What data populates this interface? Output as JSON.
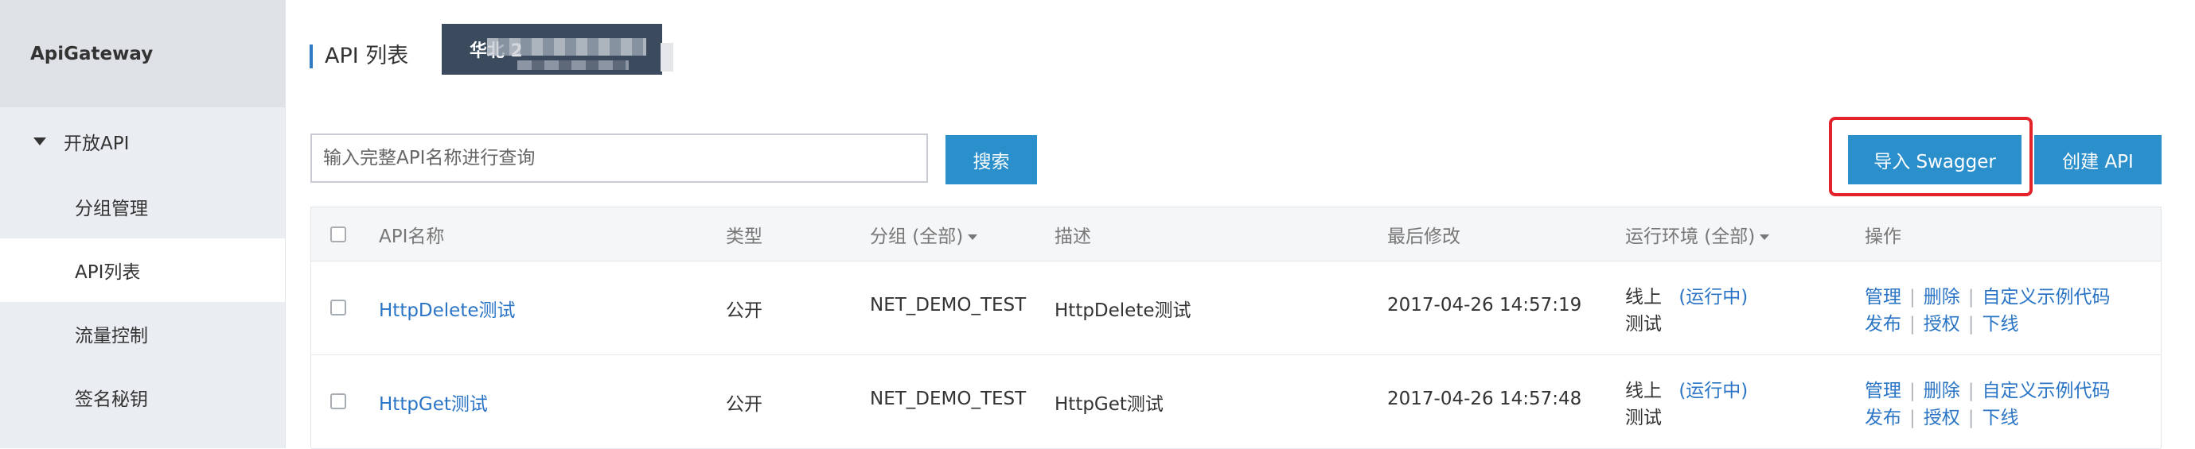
{
  "sidebar": {
    "title": "ApiGateway",
    "group_label": "开放API",
    "items": [
      {
        "label": "分组管理",
        "active": false
      },
      {
        "label": "API列表",
        "active": true
      },
      {
        "label": "流量控制",
        "active": false
      },
      {
        "label": "签名秘钥",
        "active": false
      }
    ]
  },
  "header": {
    "page_title": "API 列表",
    "region_label": "华北 2"
  },
  "search": {
    "placeholder": "输入完整API名称进行查询",
    "value": "",
    "button_label": "搜索"
  },
  "actions": {
    "import_label": "导入 Swagger",
    "create_label": "创建 API"
  },
  "table": {
    "headers": {
      "name": "API名称",
      "type": "类型",
      "group": "分组 (全部)",
      "desc": "描述",
      "modified": "最后修改",
      "env": "运行环境 (全部)",
      "ops": "操作"
    },
    "rows": [
      {
        "name": "HttpDelete测试",
        "type": "公开",
        "group": "NET_DEMO_TEST",
        "desc": "HttpDelete测试",
        "modified": "2017-04-26 14:57:19",
        "env_line1": "线上",
        "env_status": "(运行中)",
        "env_line2": "测试",
        "op_manage": "管理",
        "op_delete": "删除",
        "op_custom_code": "自定义示例代码",
        "op_publish": "发布",
        "op_authorize": "授权",
        "op_offline": "下线"
      },
      {
        "name": "HttpGet测试",
        "type": "公开",
        "group": "NET_DEMO_TEST",
        "desc": "HttpGet测试",
        "modified": "2017-04-26 14:57:48",
        "env_line1": "线上",
        "env_status": "(运行中)",
        "env_line2": "测试",
        "op_manage": "管理",
        "op_delete": "删除",
        "op_custom_code": "自定义示例代码",
        "op_publish": "发布",
        "op_authorize": "授权",
        "op_offline": "下线"
      }
    ]
  },
  "colors": {
    "primary_button": "#2a8fcb",
    "link": "#2a74c6",
    "highlight": "#e3222b",
    "sidebar_bg": "#eaedf1"
  }
}
